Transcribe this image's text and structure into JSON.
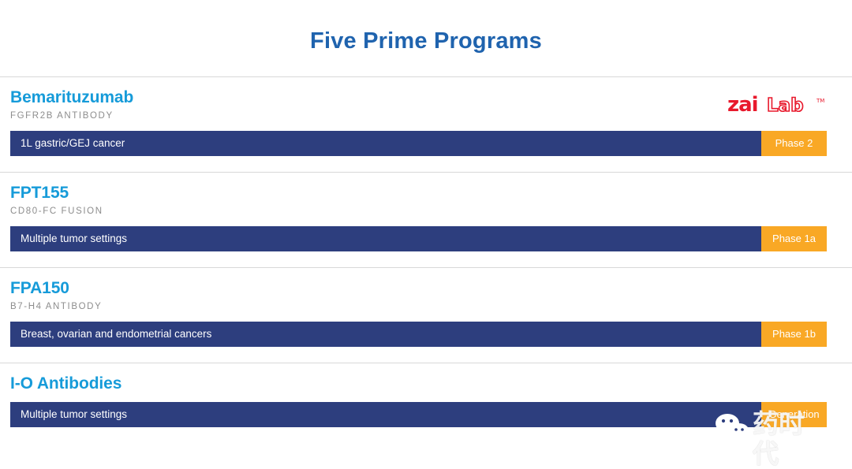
{
  "header": {
    "title": "Five Prime Programs",
    "title_color": "#1f63ae"
  },
  "colors": {
    "program_name": "#169bd9",
    "bar_navy": "#2d3e7e",
    "phase_orange": "#f9a825",
    "divider": "#d8d8d8",
    "logo_red": "#e8192c"
  },
  "partner_logo": {
    "name": "zai Lab",
    "part_bold": "zai",
    "part_outline": "Lab",
    "trademark": "™"
  },
  "programs": [
    {
      "name": "Bemarituzumab",
      "target": "FGFR2B ANTIBODY",
      "indication": "1L gastric/GEJ cancer",
      "phase": "Phase 2"
    },
    {
      "name": "FPT155",
      "target": "CD80-FC FUSION",
      "indication": "Multiple tumor settings",
      "phase": "Phase 1a"
    },
    {
      "name": "FPA150",
      "target": "B7-H4 ANTIBODY",
      "indication": "Breast, ovarian and endometrial cancers",
      "phase": "Phase 1b"
    },
    {
      "name": "I-O Antibodies",
      "target": "",
      "indication": "Multiple tumor settings",
      "phase": "Generation"
    }
  ],
  "watermark": {
    "chinese": "药时代",
    "english": "Generation",
    "icon": "wechat-icon"
  }
}
